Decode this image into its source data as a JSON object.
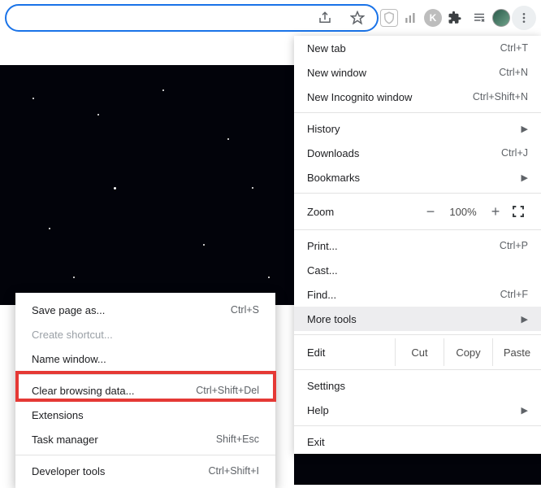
{
  "toolbar": {
    "share_icon": "share",
    "star_icon": "star",
    "ext1": "shield",
    "ext2": "bars",
    "ext3": "K",
    "ext4": "puzzle",
    "ext5": "playlist"
  },
  "menu": {
    "new_tab": "New tab",
    "new_tab_sc": "Ctrl+T",
    "new_window": "New window",
    "new_window_sc": "Ctrl+N",
    "incognito": "New Incognito window",
    "incognito_sc": "Ctrl+Shift+N",
    "history": "History",
    "downloads": "Downloads",
    "downloads_sc": "Ctrl+J",
    "bookmarks": "Bookmarks",
    "zoom_label": "Zoom",
    "zoom_value": "100%",
    "print": "Print...",
    "print_sc": "Ctrl+P",
    "cast": "Cast...",
    "find": "Find...",
    "find_sc": "Ctrl+F",
    "more_tools": "More tools",
    "edit": "Edit",
    "cut": "Cut",
    "copy": "Copy",
    "paste": "Paste",
    "settings": "Settings",
    "help": "Help",
    "exit": "Exit"
  },
  "sub": {
    "save_page": "Save page as...",
    "save_page_sc": "Ctrl+S",
    "create_shortcut": "Create shortcut...",
    "name_window": "Name window...",
    "clear_data": "Clear browsing data...",
    "clear_data_sc": "Ctrl+Shift+Del",
    "extensions": "Extensions",
    "task_mgr": "Task manager",
    "task_mgr_sc": "Shift+Esc",
    "dev_tools": "Developer tools",
    "dev_tools_sc": "Ctrl+Shift+I"
  }
}
